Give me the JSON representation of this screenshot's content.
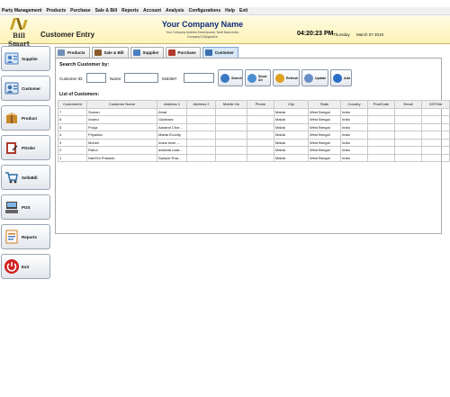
{
  "menu": [
    "Party Management",
    "Products",
    "Purchase",
    "Sale & Bill",
    "Reports",
    "Account",
    "Analysis",
    "Configurations",
    "Help",
    "Exit"
  ],
  "header": {
    "logo_text": "Bill Smart",
    "title": "Customer Entry",
    "company_name": "Your Company Name",
    "company_address": "Your Company Address,Kanchipuram,Tamil Nadu,India.",
    "company_email": "Company123@gmail.in",
    "time": "04:20:23 PM",
    "day": "Thursday",
    "date": "March 07 2019"
  },
  "sidebar": [
    {
      "label": "Supplier",
      "icon": "supplier-icon",
      "color": "#4a7fc1"
    },
    {
      "label": "Customer",
      "icon": "customer-icon",
      "color": "#3d6fb0"
    },
    {
      "label": "Product",
      "icon": "product-icon",
      "color": "#c98a2b"
    },
    {
      "label": "POrder",
      "icon": "purchase-order-icon",
      "color": "#b03a2e"
    },
    {
      "label": "SellsBill",
      "icon": "cart-icon",
      "color": "#2b6ea8"
    },
    {
      "label": "POS",
      "icon": "pos-icon",
      "color": "#333333"
    },
    {
      "label": "Reports",
      "icon": "reports-icon",
      "color": "#d07a1f"
    },
    {
      "label": "Exit",
      "icon": "power-icon",
      "color": "#d21f1f"
    }
  ],
  "tabs": [
    {
      "label": "Products",
      "color": "#6f8fb8"
    },
    {
      "label": "Sale & Bill",
      "color": "#8b5a2b"
    },
    {
      "label": "Supplier",
      "color": "#4a7fc1"
    },
    {
      "label": "Purchase",
      "color": "#b03a2e"
    },
    {
      "label": "Customer",
      "color": "#3d6fb0"
    }
  ],
  "search": {
    "title": "Search Customer by:",
    "customer_id_label": "Customer ID:",
    "name_label": "Name:",
    "mobile_label": "Mobile#:",
    "customer_id_value": "",
    "name_value": "",
    "mobile_value": ""
  },
  "buttons": [
    {
      "label": "Search",
      "color": "#3b78c4"
    },
    {
      "label": "Show All",
      "color": "#4b8fd1"
    },
    {
      "label": "Refresh",
      "color": "#e0a020"
    },
    {
      "label": "Update",
      "color": "#6a8ec8"
    },
    {
      "label": "Add",
      "color": "#2a6ec8"
    }
  ],
  "list_title": "List of Customers:",
  "table": {
    "columns": [
      "CustomerId",
      "Customer Name",
      "Address 1",
      "Address 2",
      "Mobile No",
      "Phone",
      "City",
      "State",
      "Country",
      "PostCode",
      "Email",
      "GSTIN#"
    ],
    "rows": [
      [
        "7",
        "Suman",
        "Amal",
        "",
        "",
        "",
        "Malda",
        "West Bengal",
        "India",
        "",
        "",
        ""
      ],
      [
        "6",
        "Anand",
        "Gulabara",
        "",
        "",
        "",
        "Malda",
        "West Bengal",
        "India",
        "",
        "",
        ""
      ],
      [
        "5",
        "Pooja",
        "Aanand Chor...",
        "",
        "",
        "",
        "Malda",
        "West Bengal",
        "India",
        "",
        "",
        ""
      ],
      [
        "4",
        "Priyanka",
        "Malda Ecocity",
        "",
        "",
        "",
        "Malda",
        "West Bengal",
        "India",
        "",
        "",
        ""
      ],
      [
        "3",
        "Mohini",
        "Indus town ...",
        "",
        "",
        "",
        "Malda",
        "West Bengal",
        "India",
        "",
        "",
        ""
      ],
      [
        "2",
        "Rahul",
        "avitanta road...",
        "",
        "",
        "",
        "Malda",
        "West Bengal",
        "India",
        "",
        "",
        ""
      ],
      [
        "1",
        "HariOm Prakash",
        "Sample Roa...",
        "",
        "",
        "",
        "Malda",
        "West Bengal",
        "India",
        "",
        "",
        ""
      ]
    ]
  }
}
